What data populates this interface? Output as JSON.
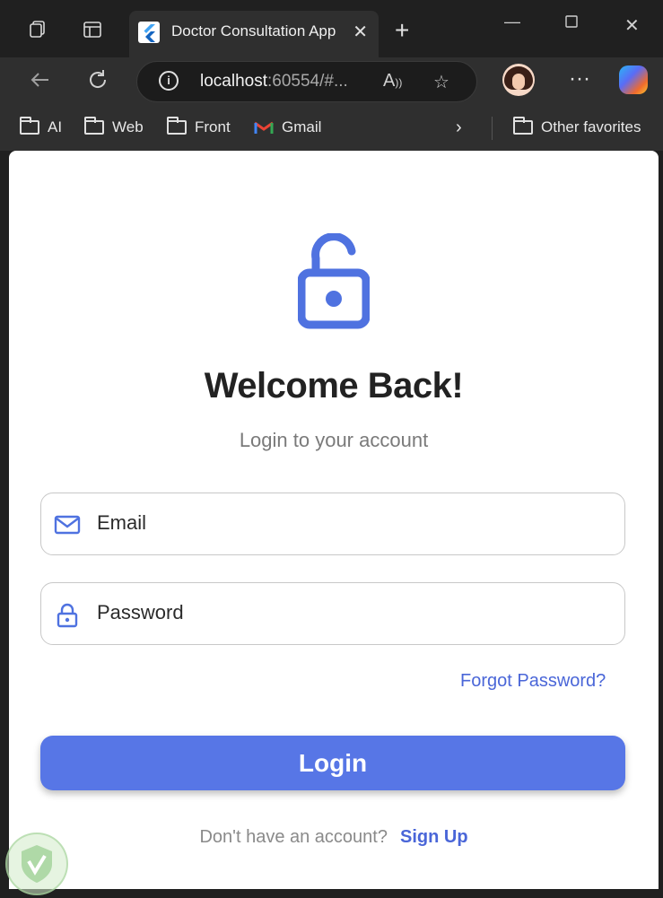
{
  "tab": {
    "title": "Doctor Consultation App"
  },
  "address_bar": {
    "host": "localhost",
    "path": ":60554/#..."
  },
  "bookmarks": {
    "items": [
      "AI",
      "Web",
      "Front",
      "Gmail"
    ],
    "other": "Other favorites"
  },
  "app": {
    "title": "Welcome Back!",
    "subtitle": "Login to your account",
    "email_placeholder": "Email",
    "password_placeholder": "Password",
    "forgot": "Forgot Password?",
    "login": "Login",
    "no_account": "Don't have an account?",
    "signup": "Sign Up"
  },
  "colors": {
    "accent": "#5776e6",
    "link": "#4a66d8",
    "icon": "#4f72e0"
  }
}
